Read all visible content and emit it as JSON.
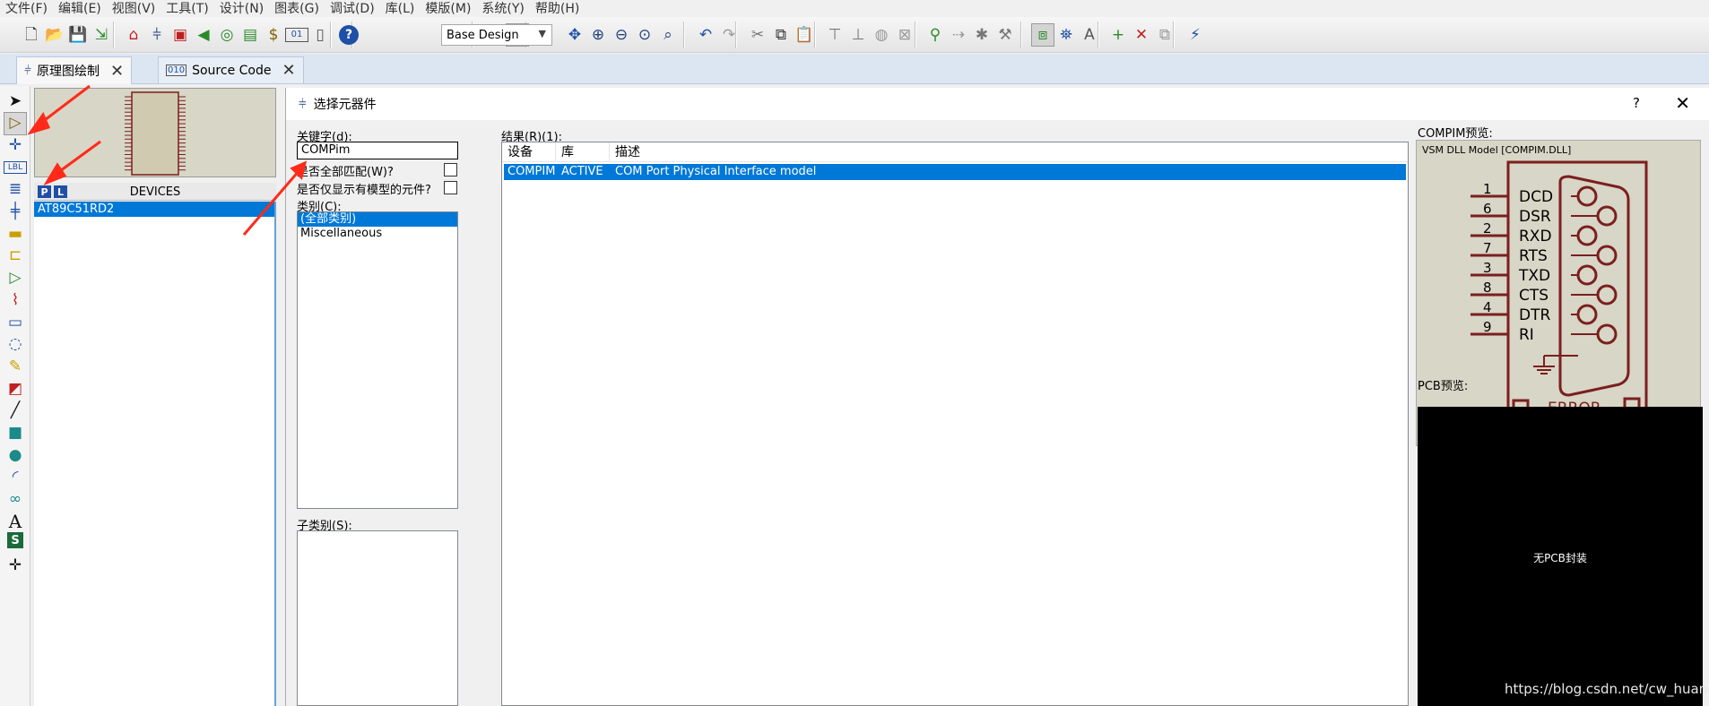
{
  "menu": [
    "文件(F)",
    "编辑(E)",
    "视图(V)",
    "工具(T)",
    "设计(N)",
    "图表(G)",
    "调试(D)",
    "库(L)",
    "模版(M)",
    "系统(Y)",
    "帮助(H)"
  ],
  "toolbar": {
    "design_select": "Base Design",
    "icons": [
      "new-file-icon",
      "open-icon",
      "save-icon",
      "import-icon",
      "home-icon",
      "schematic-icon",
      "chip-icon",
      "back-annotate-icon",
      "3d-icon",
      "pcb-icon",
      "bom-icon",
      "bin-icon",
      "notes-icon",
      "help-icon",
      "refresh-icon",
      "grid-icon",
      "origin-icon",
      "pan-icon",
      "zoom-in-icon",
      "zoom-out-icon",
      "zoom-all-icon",
      "zoom-area-icon",
      "undo-icon",
      "redo-icon",
      "cut-icon",
      "copy-icon",
      "paste-icon",
      "block-copy-icon",
      "block-move-icon",
      "block-rotate-icon",
      "block-delete-icon",
      "pick-device-icon",
      "make-device-icon",
      "package-tool-icon",
      "decompose-icon",
      "wire-autorouter-icon",
      "search-tag-icon",
      "property-tool-icon",
      "new-sheet-icon",
      "delete-sheet-icon",
      "goto-sheet-icon",
      "netlist-icon"
    ]
  },
  "tabs": [
    {
      "label": "原理图绘制",
      "icon": "schematic-tab-icon"
    },
    {
      "label": "Source Code",
      "icon": "source-code-icon"
    }
  ],
  "tools": [
    "selection-icon",
    "component-icon",
    "junction-icon",
    "wire-label-icon",
    "text-script-icon",
    "bus-icon",
    "subcircuit-icon",
    "terminals-icon",
    "device-pins-icon",
    "graph-icon",
    "tape-recorder-icon",
    "generator-icon",
    "voltage-probe-icon",
    "current-probe-icon",
    "line-icon",
    "box-icon",
    "circle-icon",
    "arc-icon",
    "path-icon",
    "text-icon",
    "symbol-icon",
    "marker-icon"
  ],
  "device_panel": {
    "p_label": "P",
    "l_label": "L",
    "title": "DEVICES",
    "items": [
      "AT89C51RD2"
    ]
  },
  "dialog": {
    "title": "选择元器件",
    "help": "?",
    "keyword_label": "关键字(d):",
    "keyword_value": "COMPim",
    "match_all_label": "是否全部匹配(W)?",
    "only_models_label": "是否仅显示有模型的元件?",
    "category_label": "类别(C):",
    "categories": [
      "(全部类别)",
      "Miscellaneous"
    ],
    "subcategory_label": "子类别(S):",
    "results_label": "结果(R)(1):",
    "columns": [
      "设备",
      "库",
      "描述"
    ],
    "results": [
      {
        "device": "COMPIM",
        "library": "ACTIVE",
        "description": "COM Port Physical Interface model"
      }
    ],
    "preview_label": "COMPIM预览:",
    "preview_caption": "VSM DLL Model [COMPIM.DLL]",
    "pins": [
      {
        "num": "1",
        "name": "DCD"
      },
      {
        "num": "6",
        "name": "DSR"
      },
      {
        "num": "2",
        "name": "RXD"
      },
      {
        "num": "7",
        "name": "RTS"
      },
      {
        "num": "3",
        "name": "TXD"
      },
      {
        "num": "8",
        "name": "CTS"
      },
      {
        "num": "4",
        "name": "DTR"
      },
      {
        "num": "9",
        "name": "RI"
      }
    ],
    "preview_error": "ERROR",
    "pcb_label": "PCB预览:",
    "pcb_message": "无PCB封装"
  },
  "watermark": "https://blog.csdn.net/cw_huang",
  "colors": {
    "selection": "#0078d7",
    "symbol": "#7a1f1f",
    "preview_bg": "#d8d6c6",
    "annotation_arrow": "#ff2a1a"
  }
}
